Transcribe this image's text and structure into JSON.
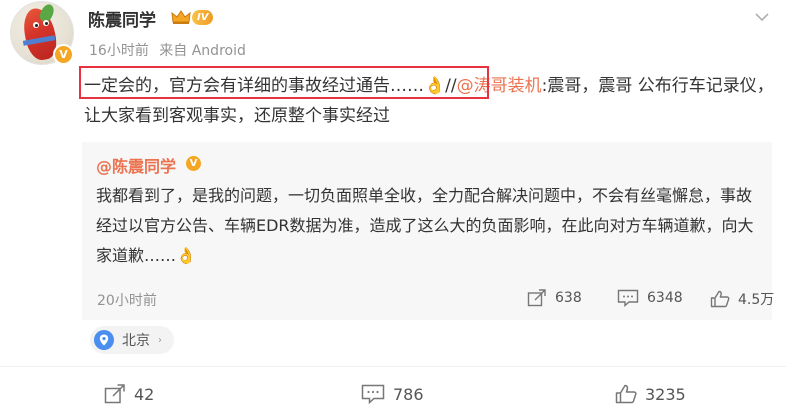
{
  "author": {
    "name": "陈震同学",
    "level_badge": "IV",
    "verified_badge": "V"
  },
  "meta": {
    "time": "16小时前",
    "source": "来自 Android"
  },
  "post": {
    "highlighted_text": "一定会的，官方会有详细的事故经过通告……",
    "emoji": "👌",
    "separator": "//",
    "mention": "@涛哥装机",
    "rest_text": ":震哥，震哥 公布行车记录仪，让大家看到客观事实，还原整个事实经过"
  },
  "repost": {
    "author": "@陈震同学",
    "verified_badge": "V",
    "text": "我都看到了，是我的问题，一切负面照单全收，全力配合解决问题中，不会有丝毫懈怠，事故经过以官方公告、车辆EDR数据为准，造成了这么大的负面影响，在此向对方车辆道歉，向大家道歉……",
    "emoji": "👌",
    "time": "20小时前",
    "repost_count": "638",
    "comment_count": "6348",
    "like_count": "4.5万"
  },
  "location": {
    "label": "北京",
    "chevron": "›"
  },
  "actions": {
    "repost_count": "42",
    "comment_count": "786",
    "like_count": "3235"
  },
  "colors": {
    "mention": "#eb7350",
    "highlight_border": "#e8323f",
    "badge_gold": "#f5a623",
    "meta_gray": "#939393"
  }
}
